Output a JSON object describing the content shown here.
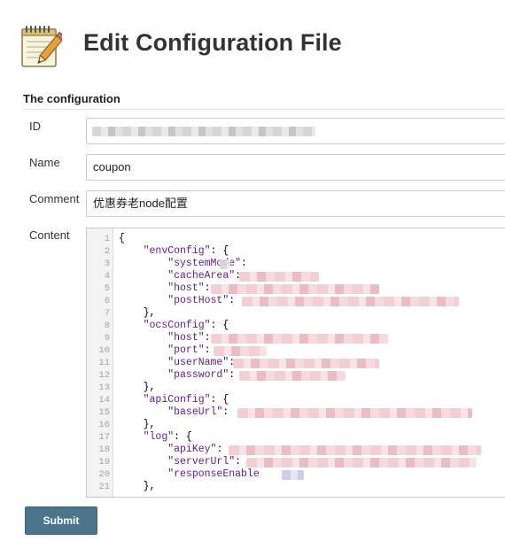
{
  "header": {
    "title": "Edit Configuration File",
    "icon": "notepad-icon"
  },
  "section": {
    "title": "The configuration"
  },
  "form": {
    "id": {
      "label": "ID",
      "value": ""
    },
    "name": {
      "label": "Name",
      "value": "coupon"
    },
    "comment": {
      "label": "Comment",
      "value": "优惠券老node配置"
    },
    "content": {
      "label": "Content"
    }
  },
  "editor": {
    "lines": [
      {
        "n": "1",
        "indent": "",
        "key": "",
        "text": "{"
      },
      {
        "n": "2",
        "indent": "    ",
        "key": "\"envConfig\"",
        "text": ": {"
      },
      {
        "n": "3",
        "indent": "        ",
        "key": "\"systemMode\"",
        "text": ":"
      },
      {
        "n": "4",
        "indent": "        ",
        "key": "\"cacheArea\"",
        "text": ":"
      },
      {
        "n": "5",
        "indent": "        ",
        "key": "\"host\"",
        "text": ":"
      },
      {
        "n": "6",
        "indent": "        ",
        "key": "\"postHost\"",
        "text": ":"
      },
      {
        "n": "7",
        "indent": "    ",
        "key": "",
        "text": "},"
      },
      {
        "n": "8",
        "indent": "    ",
        "key": "\"ocsConfig\"",
        "text": ": {"
      },
      {
        "n": "9",
        "indent": "        ",
        "key": "\"host\"",
        "text": ":"
      },
      {
        "n": "10",
        "indent": "        ",
        "key": "\"port\"",
        "text": ":"
      },
      {
        "n": "11",
        "indent": "        ",
        "key": "\"userName\"",
        "text": ":"
      },
      {
        "n": "12",
        "indent": "        ",
        "key": "\"password\"",
        "text": ":"
      },
      {
        "n": "13",
        "indent": "    ",
        "key": "",
        "text": "},"
      },
      {
        "n": "14",
        "indent": "    ",
        "key": "\"apiConfig\"",
        "text": ": {"
      },
      {
        "n": "15",
        "indent": "        ",
        "key": "\"baseUrl\"",
        "text": ":"
      },
      {
        "n": "16",
        "indent": "    ",
        "key": "",
        "text": "},"
      },
      {
        "n": "17",
        "indent": "    ",
        "key": "\"log\"",
        "text": ": {"
      },
      {
        "n": "18",
        "indent": "        ",
        "key": "\"apiKey\"",
        "text": ":"
      },
      {
        "n": "19",
        "indent": "        ",
        "key": "\"serverUrl\"",
        "text": ":"
      },
      {
        "n": "20",
        "indent": "        ",
        "key": "\"responseEnable",
        "text": ""
      },
      {
        "n": "21",
        "indent": "    ",
        "key": "",
        "text": "},"
      }
    ]
  },
  "actions": {
    "submit_label": "Submit"
  },
  "colors": {
    "submit_bg": "#4b758b",
    "key_color": "#5b1d8f",
    "gutter_bg": "#f3f3f3"
  }
}
